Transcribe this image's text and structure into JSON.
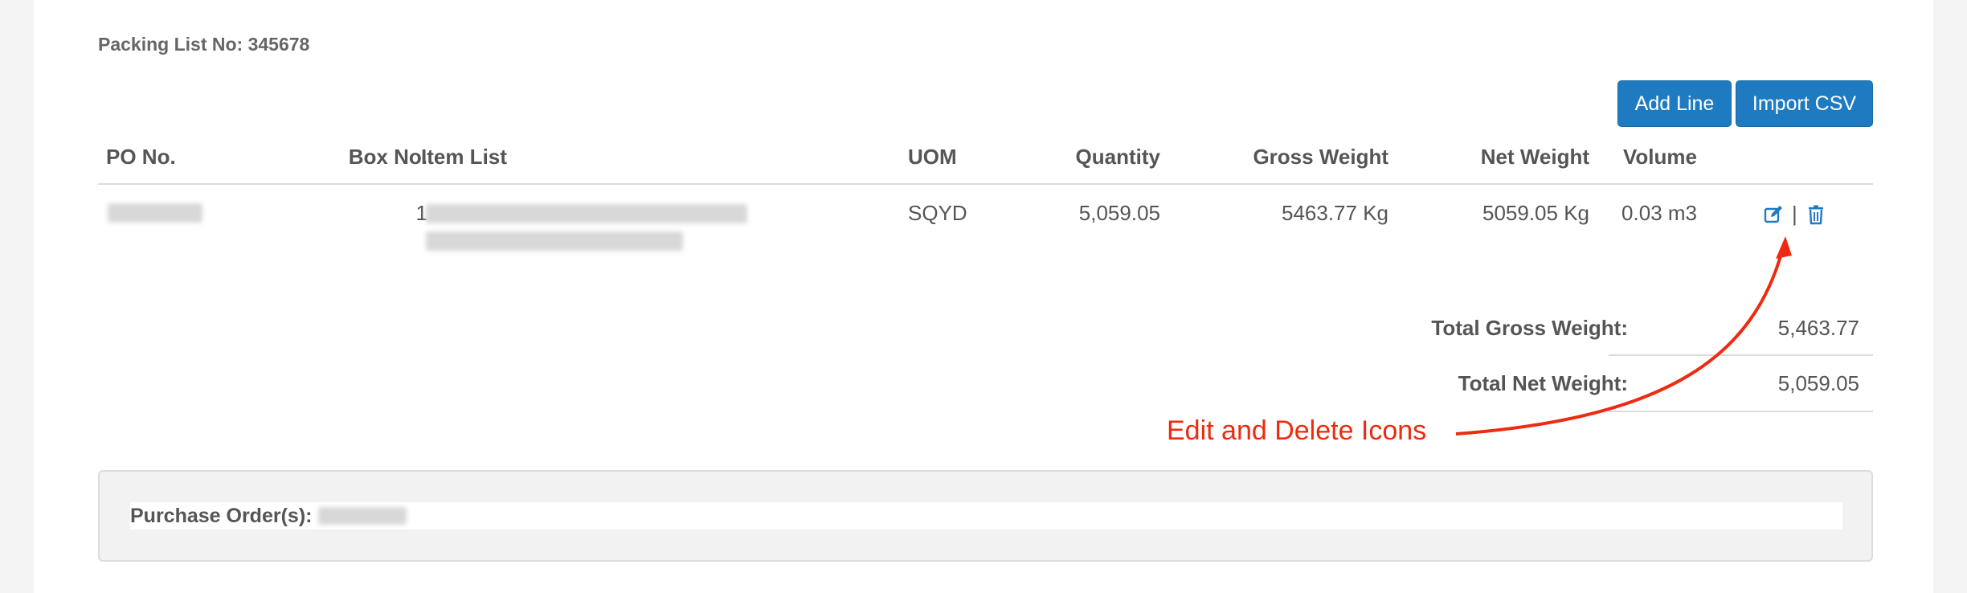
{
  "packing_list": {
    "label": "Packing List No:",
    "number": "345678"
  },
  "toolbar": {
    "add_line_label": "Add Line",
    "import_csv_label": "Import CSV"
  },
  "table": {
    "columns": [
      "PO No.",
      "Box No.",
      "Item List",
      "UOM",
      "Quantity",
      "Gross Weight",
      "Net Weight",
      "Volume"
    ],
    "rows": [
      {
        "box_no": "1",
        "uom": "SQYD",
        "quantity": "5,059.05",
        "gross_weight": "5463.77 Kg",
        "net_weight": "5059.05 Kg",
        "volume": "0.03 m3",
        "actions_separator": "|"
      }
    ]
  },
  "icons": {
    "edit": "edit-icon",
    "delete": "trash-icon"
  },
  "totals": {
    "gross_label": "Total Gross Weight:",
    "gross_value": "5,463.77",
    "net_label": "Total Net Weight:",
    "net_value": "5,059.05"
  },
  "annotation": {
    "text": "Edit and Delete Icons",
    "color": "#ee2a10"
  },
  "purchase_orders": {
    "label": "Purchase Order(s):"
  },
  "colors": {
    "primary": "#1f7bc1",
    "background": "#f4f4f4"
  }
}
